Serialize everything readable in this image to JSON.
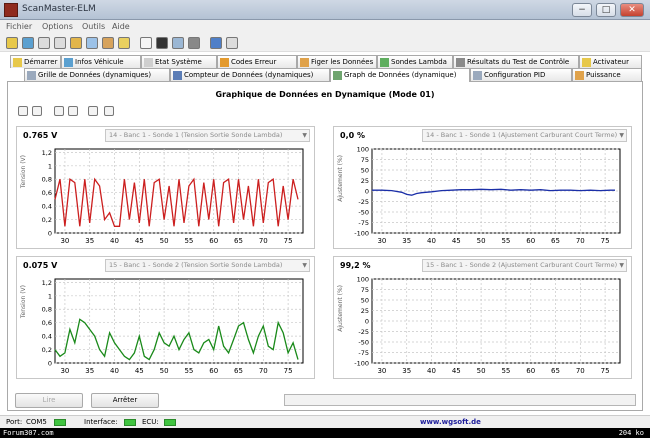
{
  "window": {
    "title": "ScanMaster-ELM",
    "minimize": "−",
    "maximize": "□",
    "close": "✕"
  },
  "menu": [
    "Fichier",
    "Options",
    "Outils",
    "Aide"
  ],
  "tabs_row1": [
    {
      "label": "Démarrer",
      "icon": "start-icon"
    },
    {
      "label": "Infos Véhicule",
      "icon": "car-icon"
    },
    {
      "label": "Etat Système",
      "icon": "system-icon"
    },
    {
      "label": "Codes Erreur",
      "icon": "warning-icon"
    },
    {
      "label": "Figer les Données",
      "icon": "freeze-icon"
    },
    {
      "label": "Sondes Lambda",
      "icon": "sensor-icon"
    },
    {
      "label": "Résultats du Test de Contrôle",
      "icon": "test-icon"
    },
    {
      "label": "Activateur",
      "icon": "activator-icon"
    }
  ],
  "tabs_row2": [
    {
      "label": "Grille de Données (dynamiques)",
      "icon": "grid-icon"
    },
    {
      "label": "Compteur de Données (dynamiques)",
      "icon": "gauge-icon"
    },
    {
      "label": "Graph de Données (dynamique)",
      "icon": "graph-icon"
    },
    {
      "label": "Configuration PID",
      "icon": "config-icon"
    },
    {
      "label": "Puissance",
      "icon": "power-icon"
    }
  ],
  "page_title": "Graphique de Données en Dynamique (Mode 01)",
  "charts": [
    {
      "value": "0.765 V",
      "value_color": "#cc1f1f",
      "pid": "14 - Banc 1 - Sonde 1 (Tension Sortie Sonde Lambda)",
      "ylabel": "Tension (V)",
      "line_color": "#cc1f1f"
    },
    {
      "value": "0,0 %",
      "value_color": "#1b2fa8",
      "pid": "14 - Banc 1 - Sonde 1 (Ajustement Carburant Court Terme)",
      "ylabel": "Ajustement (%)",
      "line_color": "#1b2fa8"
    },
    {
      "value": "0.075 V",
      "value_color": "#1a8a1a",
      "pid": "15 - Banc 1 - Sonde 2 (Tension Sortie Sonde Lambda)",
      "ylabel": "Tension (V)",
      "line_color": "#1a8a1a"
    },
    {
      "value": "99,2 %",
      "value_color": "#cc1f1f",
      "pid": "15 - Banc 1 - Sonde 2 (Ajustement Carburant Court Terme)",
      "ylabel": "Ajustement (%)",
      "line_color": "#1b2fa8"
    }
  ],
  "chart_data": [
    {
      "type": "line",
      "x": [
        28,
        29,
        30,
        31,
        32,
        33,
        34,
        35,
        36,
        37,
        38,
        39,
        40,
        41,
        42,
        43,
        44,
        45,
        46,
        47,
        48,
        49,
        50,
        51,
        52,
        53,
        54,
        55,
        56,
        57,
        58,
        59,
        60,
        61,
        62,
        63,
        64,
        65,
        66,
        67,
        68,
        69,
        70,
        71,
        72,
        73,
        74,
        75,
        76,
        77
      ],
      "series": [
        {
          "values": [
            0.5,
            0.8,
            0.1,
            0.8,
            0.75,
            0.1,
            0.8,
            0.15,
            0.8,
            0.7,
            0.2,
            0.3,
            0.1,
            0.1,
            0.8,
            0.2,
            0.75,
            0.15,
            0.8,
            0.1,
            0.75,
            0.8,
            0.2,
            0.7,
            0.1,
            0.8,
            0.15,
            0.7,
            0.8,
            0.1,
            0.75,
            0.2,
            0.8,
            0.1,
            0.75,
            0.8,
            0.15,
            0.8,
            0.2,
            0.7,
            0.1,
            0.8,
            0.15,
            0.75,
            0.8,
            0.1,
            0.7,
            0.2,
            0.8,
            0.5
          ]
        }
      ],
      "xticks": [
        30,
        35,
        40,
        45,
        50,
        55,
        60,
        65,
        70,
        75
      ],
      "yticks": [
        0,
        0.2,
        0.4,
        0.6,
        0.8,
        1.0,
        1.2
      ],
      "ytick_labels": [
        "0",
        "0,2",
        "0,4",
        "0,6",
        "0,8",
        "1",
        "1,2"
      ],
      "xlim": [
        28,
        78
      ],
      "ylim": [
        0,
        1.25
      ],
      "grid": true
    },
    {
      "type": "line",
      "x": [
        28,
        30,
        32,
        34,
        35,
        36,
        37,
        38,
        40,
        42,
        44,
        46,
        48,
        50,
        52,
        54,
        56,
        58,
        60,
        62,
        64,
        66,
        68,
        70,
        72,
        74,
        76,
        77
      ],
      "series": [
        {
          "values": [
            2,
            2,
            1,
            -3,
            -8,
            -10,
            -6,
            -4,
            -2,
            1,
            2,
            3,
            3,
            4,
            3,
            4,
            2,
            3,
            2,
            3,
            1,
            2,
            2,
            1,
            2,
            1,
            2,
            2
          ]
        }
      ],
      "xticks": [
        30,
        35,
        40,
        45,
        50,
        55,
        60,
        65,
        70,
        75
      ],
      "yticks": [
        -100,
        -75,
        -50,
        -25,
        0,
        25,
        50,
        75,
        100
      ],
      "xlim": [
        28,
        78
      ],
      "ylim": [
        -100,
        100
      ],
      "grid": true
    },
    {
      "type": "line",
      "x": [
        28,
        29,
        30,
        31,
        32,
        33,
        34,
        35,
        36,
        37,
        38,
        39,
        40,
        41,
        42,
        43,
        44,
        45,
        46,
        47,
        48,
        49,
        50,
        51,
        52,
        53,
        54,
        55,
        56,
        57,
        58,
        59,
        60,
        61,
        62,
        63,
        64,
        65,
        66,
        67,
        68,
        69,
        70,
        71,
        72,
        73,
        74,
        75,
        76,
        77
      ],
      "series": [
        {
          "values": [
            0.2,
            0.1,
            0.15,
            0.5,
            0.3,
            0.65,
            0.6,
            0.5,
            0.4,
            0.2,
            0.1,
            0.45,
            0.3,
            0.2,
            0.1,
            0.05,
            0.15,
            0.4,
            0.1,
            0.05,
            0.2,
            0.45,
            0.3,
            0.25,
            0.4,
            0.2,
            0.35,
            0.45,
            0.2,
            0.15,
            0.3,
            0.35,
            0.2,
            0.55,
            0.25,
            0.15,
            0.35,
            0.55,
            0.6,
            0.35,
            0.15,
            0.4,
            0.55,
            0.25,
            0.2,
            0.6,
            0.45,
            0.15,
            0.3,
            0.05
          ]
        }
      ],
      "xticks": [
        30,
        35,
        40,
        45,
        50,
        55,
        60,
        65,
        70,
        75
      ],
      "yticks": [
        0,
        0.2,
        0.4,
        0.6,
        0.8,
        1.0,
        1.2
      ],
      "ytick_labels": [
        "0",
        "0,2",
        "0,4",
        "0,6",
        "0,8",
        "1",
        "1,2"
      ],
      "xlim": [
        28,
        78
      ],
      "ylim": [
        0,
        1.25
      ],
      "grid": true
    },
    {
      "type": "line",
      "x": [],
      "series": [
        {
          "values": []
        }
      ],
      "xticks": [
        30,
        35,
        40,
        45,
        50,
        55,
        60,
        65,
        70,
        75
      ],
      "yticks": [
        -100,
        -75,
        -50,
        -25,
        0,
        25,
        50,
        75,
        100
      ],
      "xlim": [
        28,
        78
      ],
      "ylim": [
        -100,
        100
      ],
      "grid": true
    }
  ],
  "buttons": {
    "start": "Lire",
    "stop": "Arrêter"
  },
  "status": {
    "port_label": "Port:",
    "port_value": "COM5",
    "interface_label": "Interface:",
    "ecu_label": "ECU:",
    "url": "www.wgsoft.de"
  },
  "watermark": {
    "left": "Forum307.com",
    "right": "204 ko"
  },
  "colors": {
    "led": "#3fc33f",
    "grid": "#c8c8c8"
  }
}
